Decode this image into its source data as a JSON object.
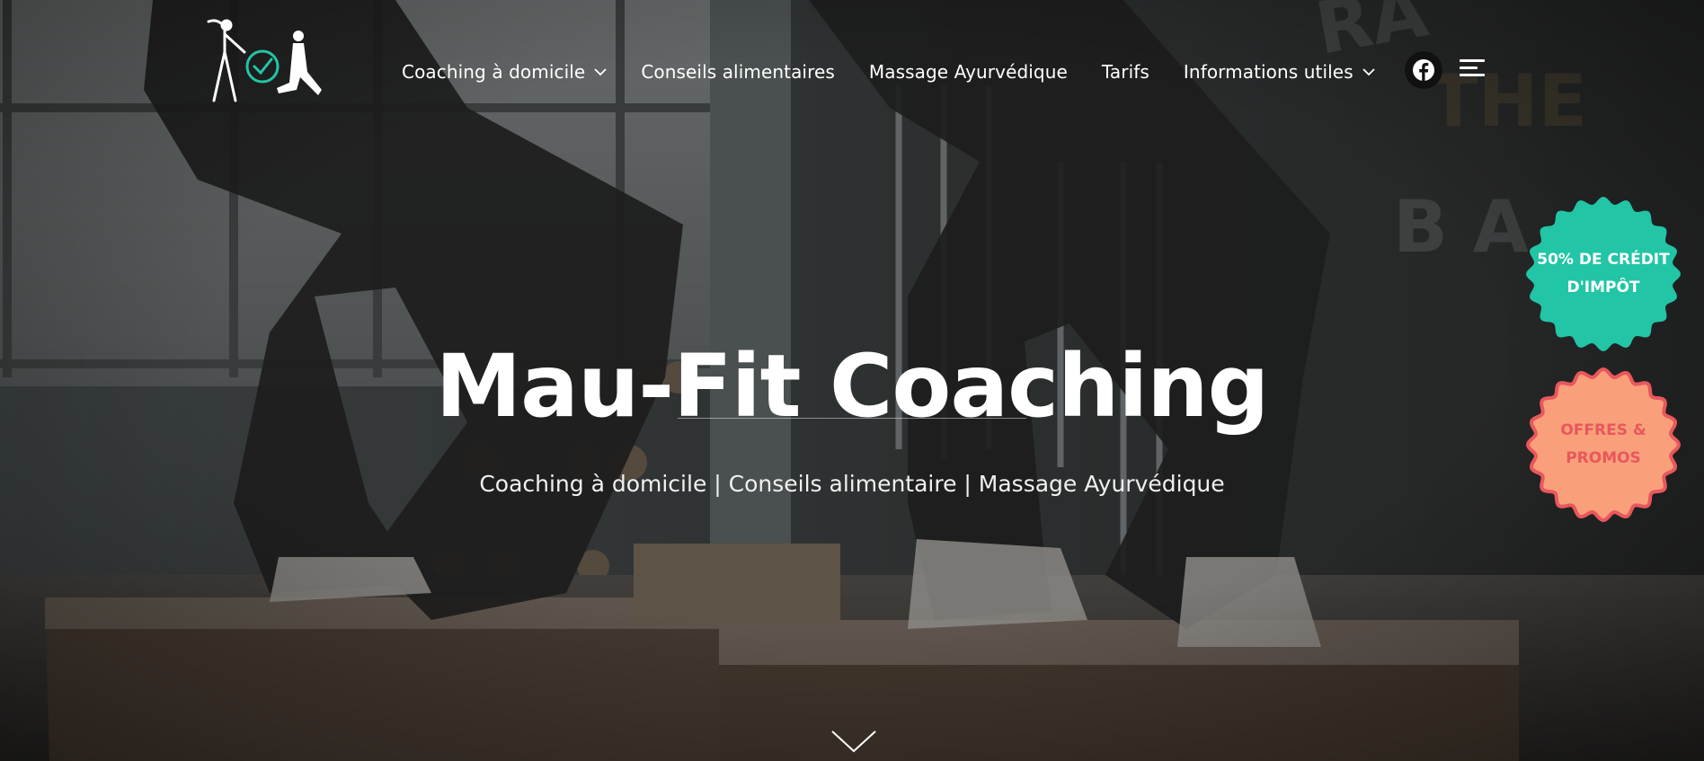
{
  "nav": {
    "items": [
      {
        "label": "Coaching à domicile",
        "dropdown": true
      },
      {
        "label": "Conseils alimentaires",
        "dropdown": false
      },
      {
        "label": "Massage Ayurvédique",
        "dropdown": false
      },
      {
        "label": "Tarifs",
        "dropdown": false
      },
      {
        "label": "Informations utiles",
        "dropdown": true
      }
    ],
    "icons": [
      "facebook-icon",
      "menu-icon"
    ]
  },
  "hero": {
    "title": "Mau-Fit Coaching",
    "subtitle": "Coaching à domicile | Conseils alimentaire | Massage Ayurvédique"
  },
  "badges": {
    "credit": {
      "line1": "50% DE CRÉDIT",
      "line2": "D'IMPÔT",
      "bg": "#22c5a6",
      "color": "#ffffff"
    },
    "offers": {
      "line1": "OFFRES &",
      "line2": "PROMOS",
      "bg": "#f9a07a",
      "border": "#e9575d",
      "color": "#e9575d"
    }
  },
  "colors": {
    "accent": "#22c5a6",
    "overlay": "#2b2d2e"
  }
}
